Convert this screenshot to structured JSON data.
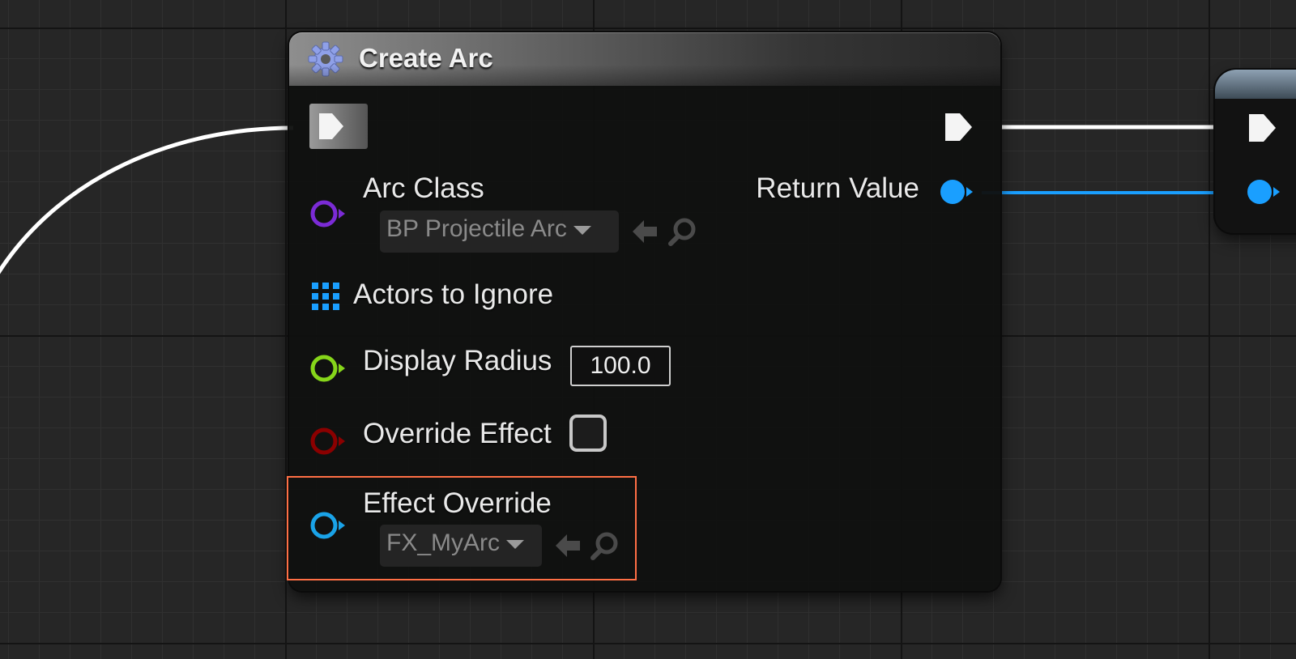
{
  "node": {
    "title": "Create Arc",
    "title_icon": "gear-icon",
    "exec_in_icon": "exec-pin-icon",
    "exec_out_icon": "exec-pin-icon",
    "pins": {
      "return_value": {
        "label": "Return Value",
        "color": "#1a9fff"
      },
      "arc_class": {
        "label": "Arc Class",
        "color": "#7b2bd6",
        "value": "BP Projectile Arc",
        "use_icon": "arrow-left-icon",
        "browse_icon": "search-icon"
      },
      "actors_to_ignore": {
        "label": "Actors to Ignore",
        "color": "#1a9fff",
        "icon": "array-grid-icon"
      },
      "display_radius": {
        "label": "Display Radius",
        "color": "#86d61a",
        "value": "100.0"
      },
      "override_effect": {
        "label": "Override Effect",
        "color": "#8b0000",
        "checked": false
      },
      "effect_override": {
        "label": "Effect Override",
        "color": "#1aa3e8",
        "value": "FX_MyArc",
        "use_icon": "arrow-left-icon",
        "browse_icon": "search-icon",
        "highlight_color": "#ff6f45"
      }
    }
  },
  "wires": {
    "exec_color": "#ffffff",
    "object_color": "#1a9fff"
  }
}
